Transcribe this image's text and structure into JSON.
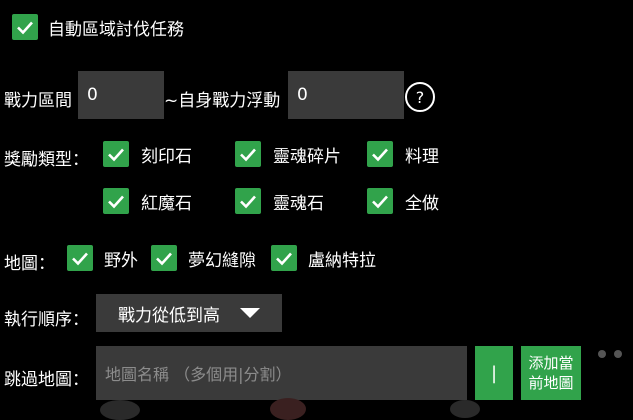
{
  "auto_quest": {
    "checked": true,
    "label": "自動區域討伐任務"
  },
  "power_range": {
    "label": "戰力區間",
    "min_value": "0",
    "float_label": "~自身戰力浮動",
    "float_value": "0",
    "help": "?"
  },
  "rewards": {
    "label": "獎勵類型：",
    "items": [
      {
        "label": "刻印石",
        "checked": true
      },
      {
        "label": "靈魂碎片",
        "checked": true
      },
      {
        "label": "料理",
        "checked": true
      },
      {
        "label": "紅魔石",
        "checked": true
      },
      {
        "label": "靈魂石",
        "checked": true
      },
      {
        "label": "全做",
        "checked": true
      }
    ]
  },
  "maps": {
    "label": "地圖：",
    "items": [
      {
        "label": "野外",
        "checked": true
      },
      {
        "label": "夢幻縫隙",
        "checked": true
      },
      {
        "label": "盧納特拉",
        "checked": true
      }
    ]
  },
  "order": {
    "label": "執行順序：",
    "selected": "戰力從低到高"
  },
  "skip_map": {
    "label": "跳過地圖：",
    "placeholder": "地圖名稱 （多個用|分割）",
    "pipe_button": "|",
    "add_button": "添加當前地圖"
  },
  "colors": {
    "accent": "#31a34b",
    "field": "#3a3a3a",
    "background": "#000000"
  }
}
